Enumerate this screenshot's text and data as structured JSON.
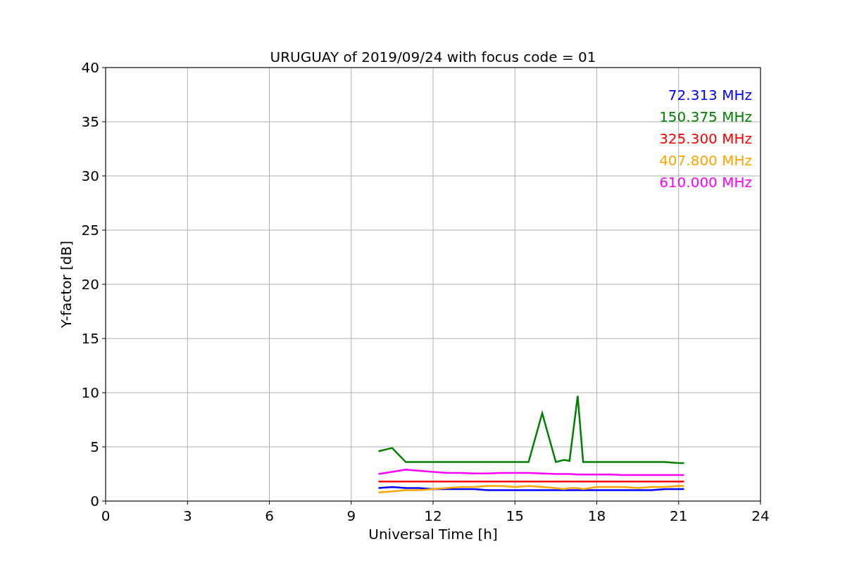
{
  "chart_data": {
    "type": "line",
    "title": "URUGUAY of 2019/09/24 with focus code = 01",
    "xlabel": "Universal Time [h]",
    "ylabel": "Y-factor [dB]",
    "x": [
      10,
      10.5,
      11,
      11.5,
      12,
      12.5,
      13,
      13.5,
      14,
      14.5,
      15,
      15.5,
      16,
      16.5,
      16.8,
      17,
      17.3,
      17.5,
      18,
      18.5,
      19,
      19.5,
      20,
      20.5,
      21,
      21.2
    ],
    "series": [
      {
        "name": "72.313 MHz",
        "color": "#0000ff",
        "values": [
          1.2,
          1.3,
          1.2,
          1.2,
          1.1,
          1.1,
          1.1,
          1.1,
          1.0,
          1.0,
          1.0,
          1.0,
          1.0,
          1.0,
          1.0,
          1.0,
          1.0,
          1.0,
          1.0,
          1.0,
          1.0,
          1.0,
          1.0,
          1.1,
          1.1,
          1.1
        ]
      },
      {
        "name": "150.375 MHz",
        "color": "#008000",
        "values": [
          4.6,
          4.9,
          3.6,
          3.6,
          3.6,
          3.6,
          3.6,
          3.6,
          3.6,
          3.6,
          3.6,
          3.6,
          8.1,
          3.6,
          3.8,
          3.7,
          9.7,
          3.6,
          3.6,
          3.6,
          3.6,
          3.6,
          3.6,
          3.6,
          3.5,
          3.5
        ]
      },
      {
        "name": "325.300 MHz",
        "color": "#ff0000",
        "values": [
          1.8,
          1.8,
          1.8,
          1.8,
          1.8,
          1.8,
          1.8,
          1.8,
          1.8,
          1.8,
          1.8,
          1.8,
          1.8,
          1.8,
          1.8,
          1.8,
          1.8,
          1.8,
          1.8,
          1.8,
          1.8,
          1.8,
          1.8,
          1.8,
          1.8,
          1.8
        ]
      },
      {
        "name": "407.800 MHz",
        "color": "#ffa500",
        "values": [
          0.8,
          0.9,
          1.0,
          1.0,
          1.1,
          1.2,
          1.3,
          1.3,
          1.4,
          1.4,
          1.3,
          1.4,
          1.3,
          1.2,
          1.1,
          1.2,
          1.2,
          1.1,
          1.3,
          1.3,
          1.3,
          1.2,
          1.3,
          1.3,
          1.4,
          1.4
        ]
      },
      {
        "name": "610.000 MHz",
        "color": "#ff00ff",
        "values": [
          2.5,
          2.7,
          2.9,
          2.8,
          2.7,
          2.6,
          2.6,
          2.55,
          2.55,
          2.6,
          2.6,
          2.6,
          2.55,
          2.5,
          2.5,
          2.5,
          2.45,
          2.45,
          2.45,
          2.45,
          2.4,
          2.4,
          2.4,
          2.4,
          2.4,
          2.4
        ]
      }
    ],
    "xlim": [
      0,
      24
    ],
    "ylim": [
      0,
      40
    ],
    "xticks": [
      0,
      3,
      6,
      9,
      12,
      15,
      18,
      21,
      24
    ],
    "yticks": [
      0,
      5,
      10,
      15,
      20,
      25,
      30,
      35,
      40
    ],
    "grid": true
  }
}
